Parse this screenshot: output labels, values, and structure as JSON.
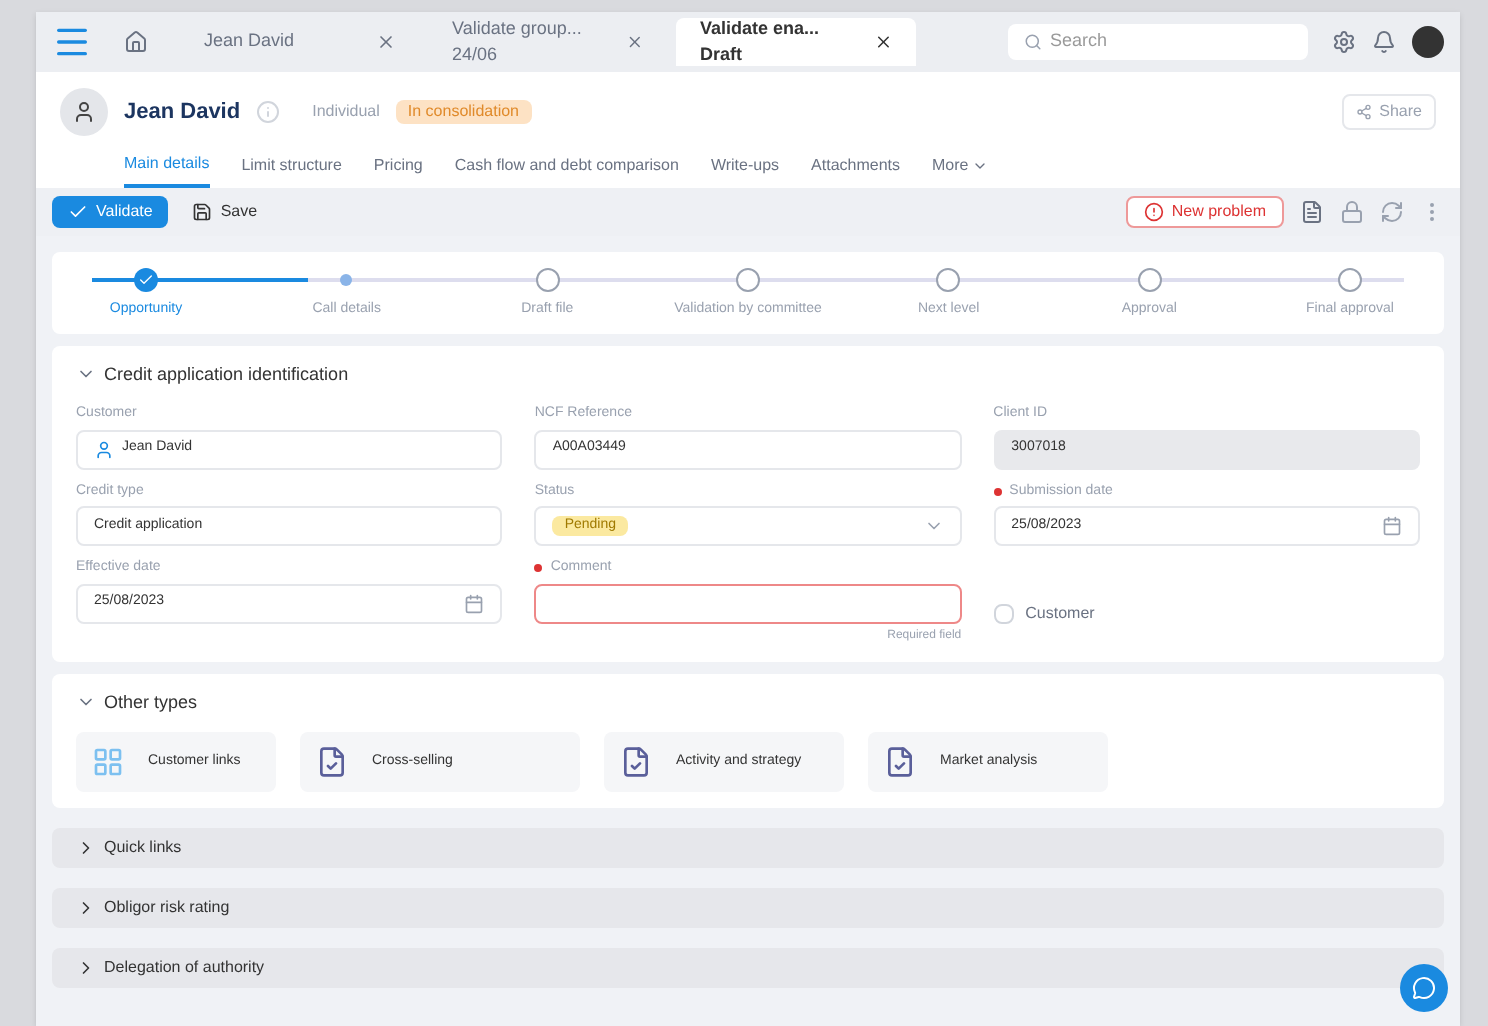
{
  "tabs": [
    {
      "label": "Jean David",
      "selected": false
    },
    {
      "label": "Validate group... 24/06",
      "selected": false
    },
    {
      "label": "Validate ena... Draft",
      "selected": true
    }
  ],
  "search": {
    "placeholder": "Search"
  },
  "header": {
    "name": "Jean David",
    "type": "Individual",
    "badge": "In consolidation",
    "share": "Share"
  },
  "subtabs": [
    {
      "label": "Main details",
      "selected": true
    },
    {
      "label": "Limit structure",
      "selected": false
    },
    {
      "label": "Pricing",
      "selected": false
    },
    {
      "label": "Cash flow and debt comparison",
      "selected": false
    },
    {
      "label": "Write-ups",
      "selected": false
    },
    {
      "label": "Attachments",
      "selected": false
    },
    {
      "label": "More",
      "selected": false
    }
  ],
  "toolbar": {
    "validate": "Validate",
    "save": "Save",
    "problem": "New problem"
  },
  "steps": [
    {
      "label": "Opportunity",
      "completed": true,
      "selected": false
    },
    {
      "label": "Call details",
      "completed": false,
      "selected": true
    },
    {
      "label": "Draft file",
      "completed": false,
      "selected": false
    },
    {
      "label": "Validation by committee",
      "completed": false,
      "selected": false
    },
    {
      "label": "Next level",
      "completed": false,
      "selected": false
    },
    {
      "label": "Approval",
      "completed": false,
      "selected": false
    },
    {
      "label": "Final approval",
      "completed": false,
      "selected": false
    }
  ],
  "identification": {
    "title": "Credit application identification",
    "fields": [
      {
        "kind": "person",
        "label": "Customer",
        "value": "Jean David",
        "required": false
      },
      {
        "kind": "text",
        "label": "NCF Reference",
        "value": "A00A03449",
        "required": false
      },
      {
        "kind": "disabled",
        "label": "Client ID",
        "value": "3007018",
        "required": false
      },
      {
        "kind": "text",
        "label": "Credit type",
        "value": "Credit application",
        "required": false
      },
      {
        "kind": "status",
        "label": "Status",
        "value": "Pending",
        "required": false
      },
      {
        "kind": "date",
        "label": "Submission date",
        "value": "25/08/2023",
        "required": true
      },
      {
        "kind": "date",
        "label": "Effective date",
        "value": "25/08/2023",
        "required": false
      },
      {
        "kind": "error",
        "label": "Comment",
        "required": true,
        "hint": "Required field"
      },
      {
        "kind": "checkbox",
        "label": "Customer",
        "checked": false
      }
    ]
  },
  "other_types": {
    "title": "Other types",
    "items": [
      {
        "label": "Customer links",
        "kind": "grid"
      },
      {
        "label": "Cross-selling",
        "kind": "doc"
      },
      {
        "label": "Activity and strategy",
        "kind": "doc"
      },
      {
        "label": "Market analysis",
        "kind": "doc"
      }
    ]
  },
  "sections": [
    {
      "label": "Quick links",
      "expanded": false
    },
    {
      "label": "Obligor risk rating",
      "expanded": false
    },
    {
      "label": "Delegation of authority",
      "expanded": false
    }
  ]
}
